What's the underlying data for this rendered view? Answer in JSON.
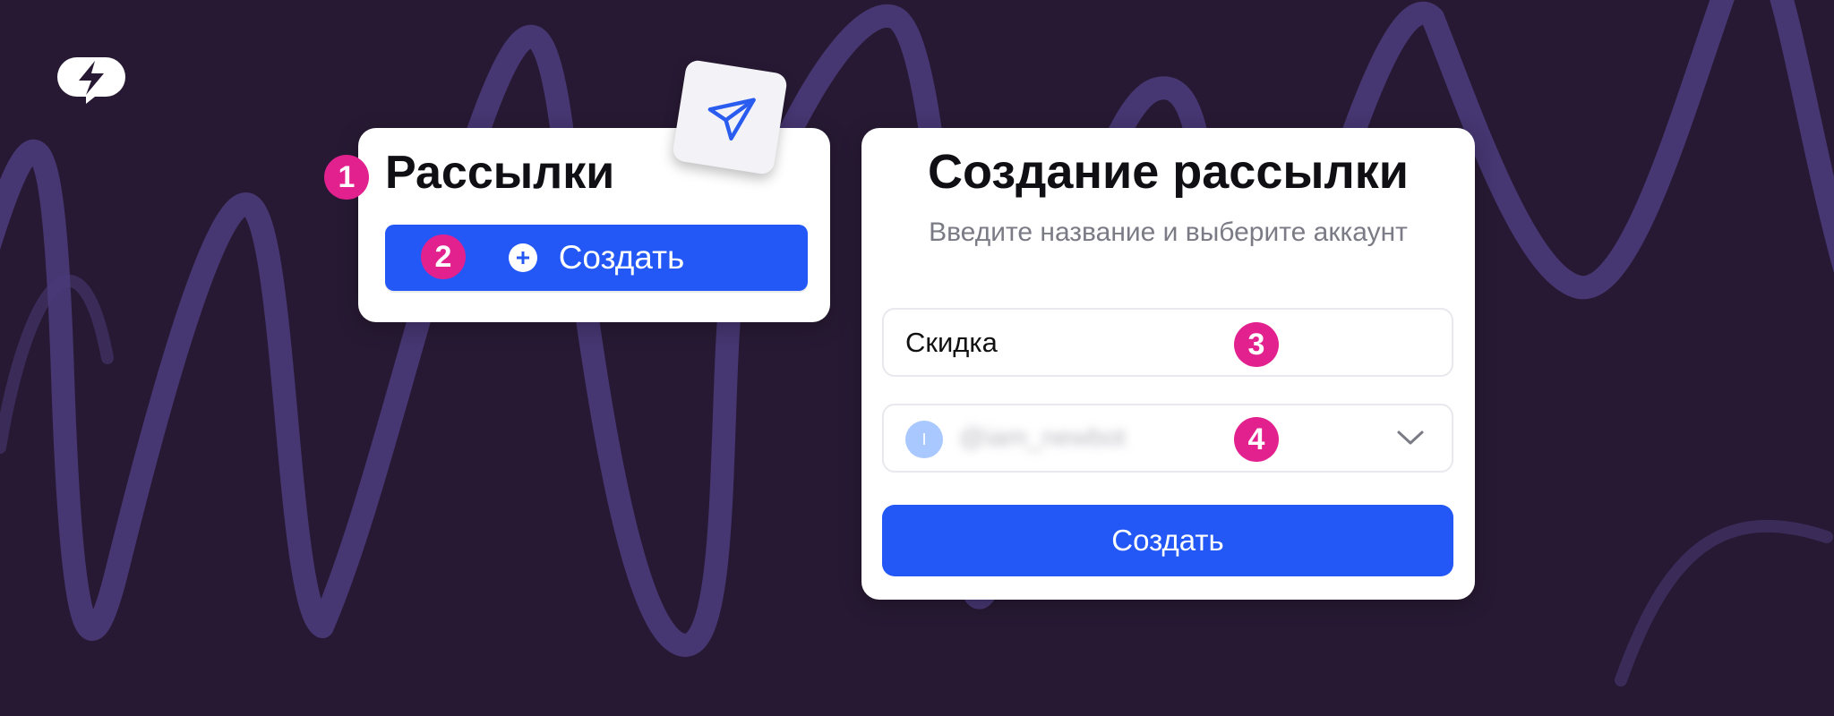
{
  "colors": {
    "background": "#271933",
    "scribble": "#4a3a78",
    "primary": "#2358f7",
    "badge": "#e2218f",
    "card": "#ffffff"
  },
  "logo": {
    "icon": "brand-logo-icon"
  },
  "mailings_card": {
    "title": "Рассылки",
    "create_button": {
      "label": "Создать",
      "icon": "plus-circle-icon"
    },
    "decor_icon": "paper-plane-icon"
  },
  "create_mailing": {
    "title": "Создание рассылки",
    "subtitle": "Введите название и выберите аккаунт",
    "name_input": {
      "value": "Скидка"
    },
    "account_select": {
      "avatar_letter": "I",
      "value": "@iam_newbot",
      "icon": "chevron-down-icon"
    },
    "submit_button": {
      "label": "Создать"
    }
  },
  "step_badges": [
    "1",
    "2",
    "3",
    "4"
  ]
}
